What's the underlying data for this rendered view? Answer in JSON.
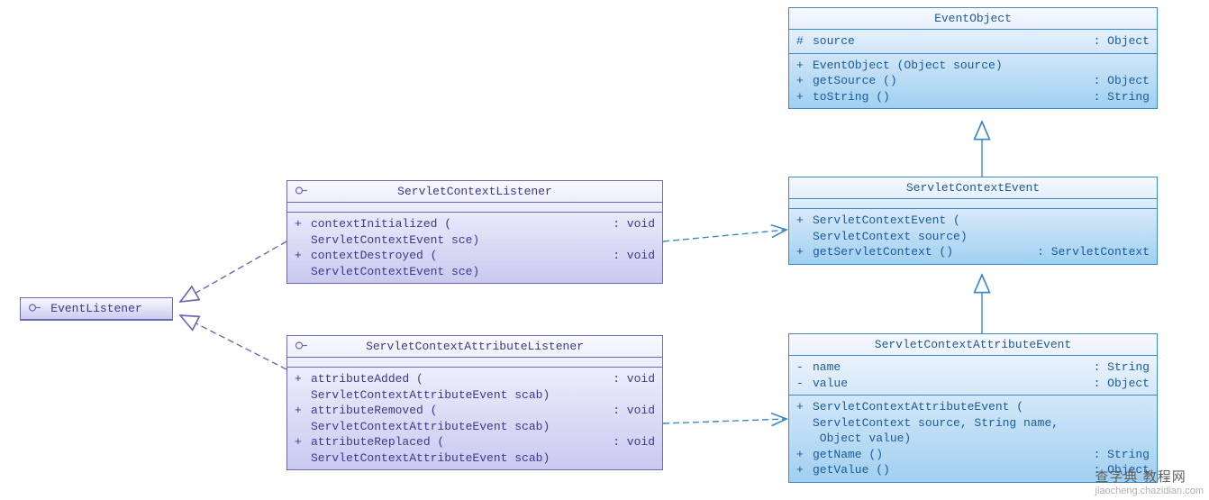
{
  "chart_data": {
    "type": "uml-class-diagram",
    "classes": [
      {
        "id": "EventListener",
        "stereotype": "interface",
        "attrs": [],
        "ops": []
      },
      {
        "id": "ServletContextListener",
        "stereotype": "interface",
        "attrs": [],
        "ops": [
          {
            "vis": "+",
            "sig": "contextInitialized (\nServletContextEvent sce)",
            "ret": ": void"
          },
          {
            "vis": "+",
            "sig": "contextDestroyed (\nServletContextEvent sce)",
            "ret": ": void"
          }
        ]
      },
      {
        "id": "ServletContextAttributeListener",
        "stereotype": "interface",
        "attrs": [],
        "ops": [
          {
            "vis": "+",
            "sig": "attributeAdded (\nServletContextAttributeEvent scab)",
            "ret": ": void"
          },
          {
            "vis": "+",
            "sig": "attributeRemoved (\nServletContextAttributeEvent scab)",
            "ret": ": void"
          },
          {
            "vis": "+",
            "sig": "attributeReplaced (\nServletContextAttributeEvent scab)",
            "ret": ": void"
          }
        ]
      },
      {
        "id": "EventObject",
        "stereotype": "class",
        "attrs": [
          {
            "vis": "#",
            "sig": "source",
            "ret": ": Object"
          }
        ],
        "ops": [
          {
            "vis": "+",
            "sig": "EventObject (Object source)",
            "ret": ""
          },
          {
            "vis": "+",
            "sig": "getSource ()",
            "ret": ": Object"
          },
          {
            "vis": "+",
            "sig": "toString ()",
            "ret": ": String"
          }
        ]
      },
      {
        "id": "ServletContextEvent",
        "stereotype": "class",
        "attrs": [],
        "ops": [
          {
            "vis": "+",
            "sig": "ServletContextEvent (\nServletContext source)",
            "ret": ""
          },
          {
            "vis": "+",
            "sig": "getServletContext ()",
            "ret": ": ServletContext"
          }
        ]
      },
      {
        "id": "ServletContextAttributeEvent",
        "stereotype": "class",
        "attrs": [
          {
            "vis": "-",
            "sig": "name",
            "ret": ": String"
          },
          {
            "vis": "-",
            "sig": "value",
            "ret": ": Object"
          }
        ],
        "ops": [
          {
            "vis": "+",
            "sig": "ServletContextAttributeEvent (\nServletContext source, String name,\n Object value)",
            "ret": ""
          },
          {
            "vis": "+",
            "sig": "getName ()",
            "ret": ": String"
          },
          {
            "vis": "+",
            "sig": "getValue ()",
            "ret": ": Object"
          }
        ]
      }
    ],
    "relations": [
      {
        "from": "ServletContextListener",
        "to": "EventListener",
        "type": "realization"
      },
      {
        "from": "ServletContextAttributeListener",
        "to": "EventListener",
        "type": "realization"
      },
      {
        "from": "ServletContextEvent",
        "to": "EventObject",
        "type": "generalization"
      },
      {
        "from": "ServletContextAttributeEvent",
        "to": "ServletContextEvent",
        "type": "generalization"
      },
      {
        "from": "ServletContextListener",
        "to": "ServletContextEvent",
        "type": "dependency"
      },
      {
        "from": "ServletContextAttributeListener",
        "to": "ServletContextAttributeEvent",
        "type": "dependency"
      }
    ]
  },
  "boxes": {
    "eventListener": {
      "title": "EventListener"
    },
    "servletContextListener": {
      "title": "ServletContextListener",
      "ops": [
        {
          "vis": "+",
          "sig": "contextInitialized (\nServletContextEvent sce)",
          "ret": ": void"
        },
        {
          "vis": "+",
          "sig": "contextDestroyed (\nServletContextEvent sce)",
          "ret": ": void"
        }
      ]
    },
    "servletContextAttributeListener": {
      "title": "ServletContextAttributeListener",
      "ops": [
        {
          "vis": "+",
          "sig": "attributeAdded (\nServletContextAttributeEvent scab)",
          "ret": ": void"
        },
        {
          "vis": "+",
          "sig": "attributeRemoved (\nServletContextAttributeEvent scab)",
          "ret": ": void"
        },
        {
          "vis": "+",
          "sig": "attributeReplaced (\nServletContextAttributeEvent scab)",
          "ret": ": void"
        }
      ]
    },
    "eventObject": {
      "title": "EventObject",
      "attrs": [
        {
          "vis": "#",
          "sig": "source  ",
          "ret": ": Object"
        }
      ],
      "ops": [
        {
          "vis": "+",
          "sig": "EventObject (Object source)",
          "ret": ""
        },
        {
          "vis": "+",
          "sig": "getSource ()              ",
          "ret": ": Object"
        },
        {
          "vis": "+",
          "sig": "toString ()               ",
          "ret": ": String"
        }
      ]
    },
    "servletContextEvent": {
      "title": "ServletContextEvent",
      "ops": [
        {
          "vis": "+",
          "sig": "ServletContextEvent (\nServletContext source)",
          "ret": ""
        },
        {
          "vis": "+",
          "sig": "getServletContext ()   ",
          "ret": ": ServletContext"
        }
      ]
    },
    "servletContextAttributeEvent": {
      "title": "ServletContextAttributeEvent",
      "attrs": [
        {
          "vis": "-",
          "sig": "name   ",
          "ret": ": String"
        },
        {
          "vis": "-",
          "sig": "value  ",
          "ret": ": Object"
        }
      ],
      "ops": [
        {
          "vis": "+",
          "sig": "ServletContextAttributeEvent (\nServletContext source, String name,\n Object value)",
          "ret": ""
        },
        {
          "vis": "+",
          "sig": "getName ()                    ",
          "ret": ": String"
        },
        {
          "vis": "+",
          "sig": "getValue ()                   ",
          "ret": ": Object"
        }
      ]
    }
  },
  "watermark": {
    "top": "查字典 教程网",
    "bottom": "jiaocheng.chazidian.com"
  },
  "colors": {
    "purpleLine": "#6a6ab0",
    "blueLine": "#3a8ac9"
  }
}
